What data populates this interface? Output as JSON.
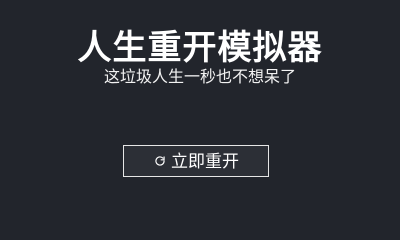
{
  "screen": {
    "title": "人生重开模拟器",
    "subtitle": "这垃圾人生一秒也不想呆了",
    "restart_button": {
      "label": "立即重开",
      "icon": "refresh-icon"
    }
  },
  "colors": {
    "background": "#22252c",
    "text": "#ffffff",
    "button_border": "#e6e6e6",
    "button_background": "#2c2f36"
  }
}
